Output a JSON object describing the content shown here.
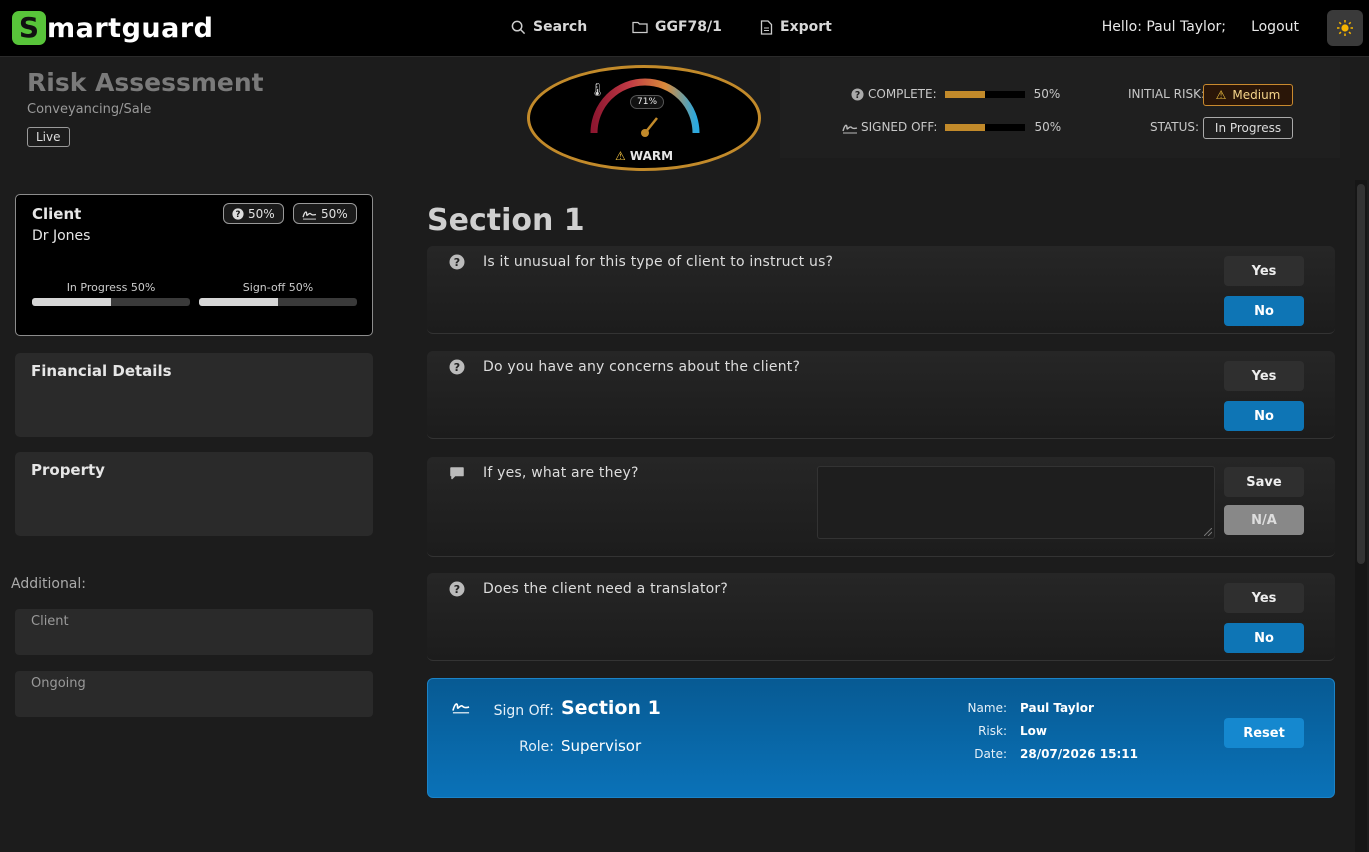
{
  "brand": {
    "logo_letter": "S",
    "logo_rest": "martguard",
    "accent": "#58c43a"
  },
  "nav": {
    "search": "Search",
    "matter": "GGF78/1",
    "export": "Export"
  },
  "user": {
    "greeting": "Hello: Paul Taylor;",
    "logout": "Logout"
  },
  "header": {
    "title": "Risk Assessment",
    "subtitle": "Conveyancing/Sale",
    "status_tag": "Live"
  },
  "gauge": {
    "percent_label": "71%",
    "percent": 71,
    "temperature_label": "WARM"
  },
  "stats": {
    "complete_label": "COMPLETE:",
    "complete_value": "50%",
    "complete_fraction": 0.5,
    "signed_label": "SIGNED OFF:",
    "signed_value": "50%",
    "signed_fraction": 0.5,
    "initial_risk_label": "INITIAL RISK:",
    "initial_risk_value": "Medium",
    "status_label": "STATUS:",
    "status_value": "In Progress"
  },
  "sidebar": {
    "client": {
      "title": "Client",
      "name": "Dr Jones",
      "complete_badge": "50%",
      "signed_badge": "50%",
      "progress_label": "In Progress 50%",
      "progress_fraction": 0.5,
      "signoff_label": "Sign-off 50%",
      "signoff_fraction": 0.5
    },
    "financial": {
      "title": "Financial Details"
    },
    "property": {
      "title": "Property"
    },
    "additional_label": "Additional:",
    "additional_items": [
      "Client",
      "Ongoing"
    ]
  },
  "main": {
    "section_title": "Section 1",
    "questions": [
      {
        "text": "Is it unusual for this type of client to instruct us?",
        "yes": "Yes",
        "no": "No"
      },
      {
        "text": "Do you have any concerns about the client?",
        "yes": "Yes",
        "no": "No"
      },
      {
        "text": "If yes, what are they?",
        "save": "Save",
        "na": "N/A"
      },
      {
        "text": "Does the client need a translator?",
        "yes": "Yes",
        "no": "No"
      }
    ],
    "signoff": {
      "signoff_label": "Sign Off:",
      "section": "Section 1",
      "role_label": "Role:",
      "role": "Supervisor",
      "name_label": "Name:",
      "name": "Paul Taylor",
      "risk_label": "Risk:",
      "risk": "Low",
      "date_label": "Date:",
      "date": "28/07/2026 15:11",
      "reset": "Reset"
    }
  }
}
